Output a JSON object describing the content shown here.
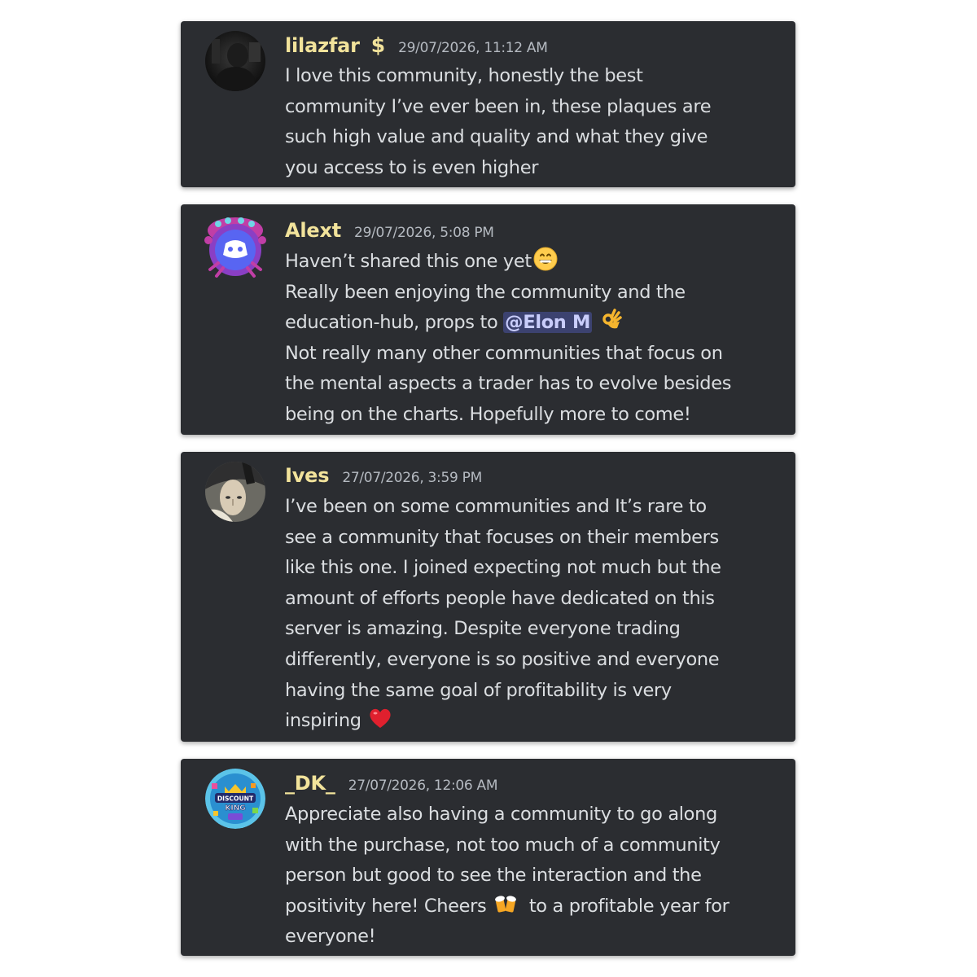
{
  "colors": {
    "card_bg": "#2b2d31",
    "username": "#f2e39b",
    "timestamp": "#b5bac1",
    "text": "#dbdee1",
    "mention_bg": "#3c4270",
    "mention_text": "#c9cdfb"
  },
  "messages": [
    {
      "username": "lilazfar",
      "badge": "$",
      "timestamp": "29/07/2026, 11:12 AM",
      "avatar_icon": "dark-photo-avatar",
      "lines": [
        "I love this community, honestly the best",
        "community I’ve ever been in, these plaques are",
        "such high value and quality and what they give",
        "you access to is even higher"
      ]
    },
    {
      "username": "Alext",
      "timestamp": "29/07/2026, 5:08 PM",
      "avatar_icon": "discord-monster-avatar",
      "lines": [
        "Haven’t shared this one yet",
        "Really been enjoying the community and the",
        "education-hub, props to ",
        "Not really many other communities that focus on",
        "the mental aspects a trader has to evolve besides",
        "being on the charts. Hopefully more to come!"
      ],
      "mention": "@Elon M",
      "emojis": [
        "grinning-face-emoji",
        "ok-hand-emoji"
      ]
    },
    {
      "username": "Ives",
      "timestamp": "27/07/2026, 3:59 PM",
      "avatar_icon": "character-portrait-avatar",
      "lines": [
        "I’ve been on some communities and It’s rare to",
        "see a community that focuses on their members",
        "like this one. I joined expecting not much but the",
        "amount of efforts people have dedicated on this",
        "server is amazing. Despite everyone trading",
        "differently, everyone is so positive and everyone",
        "having the same goal of profitability is very",
        "inspiring "
      ],
      "emojis": [
        "red-heart-emoji"
      ]
    },
    {
      "username": "_DK_",
      "timestamp": "27/07/2026, 12:06 AM",
      "avatar_icon": "discount-king-logo-avatar",
      "avatar_text": [
        "DISCOUNT",
        "KING"
      ],
      "lines": [
        "Appreciate also having a community to go along",
        "with the purchase, not too much of a community",
        "person but good to see the interaction and the",
        "positivity here! Cheers ",
        "  to a profitable year for",
        "everyone!"
      ],
      "emojis": [
        "beer-mugs-emoji"
      ]
    }
  ]
}
